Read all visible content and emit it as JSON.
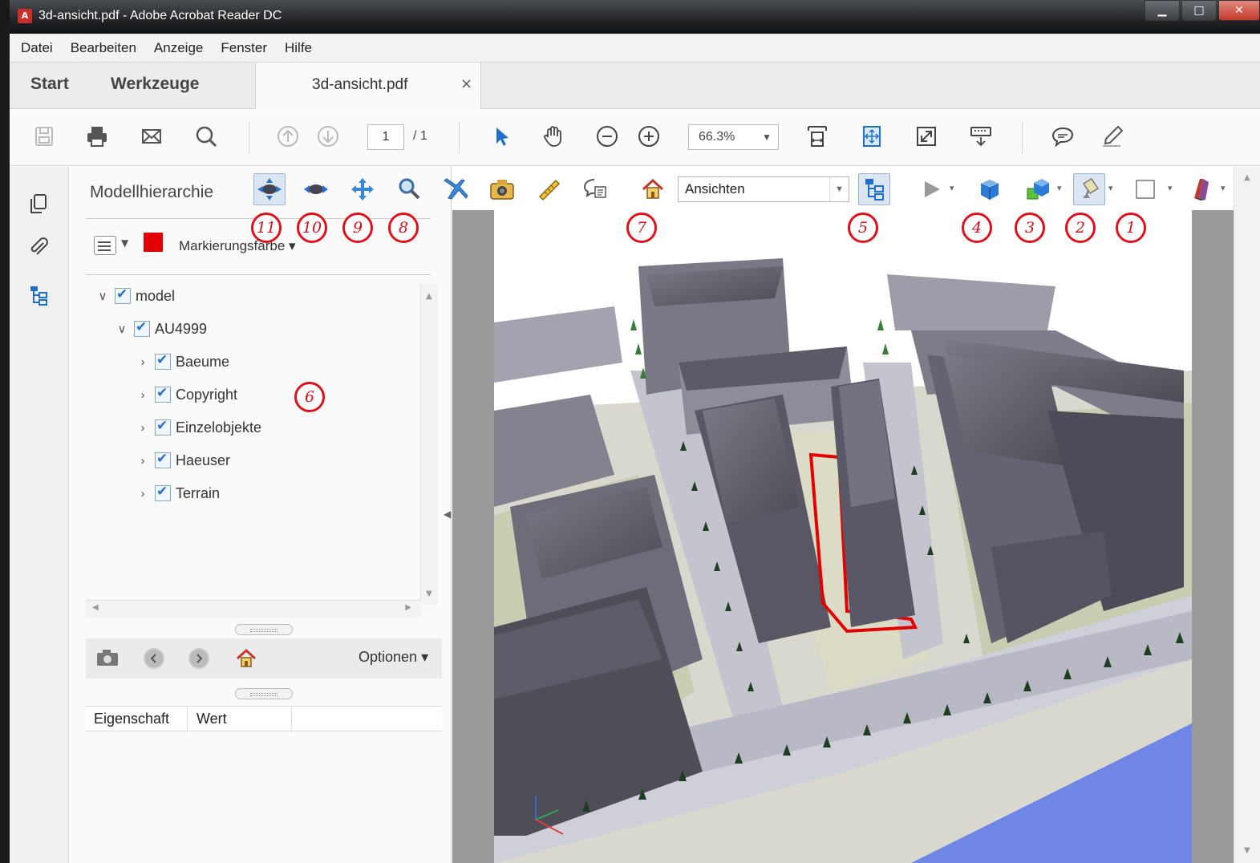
{
  "window": {
    "title": "3d-ansicht.pdf - Adobe Acrobat Reader DC"
  },
  "menu": [
    "Datei",
    "Bearbeiten",
    "Anzeige",
    "Fenster",
    "Hilfe"
  ],
  "tabs": {
    "start": "Start",
    "tools": "Werkzeuge",
    "document": "3d-ansicht.pdf",
    "close": "×"
  },
  "toolbar": {
    "page_current": "1",
    "page_total": "/ 1",
    "zoom": "66.3%"
  },
  "panel": {
    "title": "Modellhierarchie",
    "marker_label": "Markierungsfarbe",
    "marker_color": "#e30000",
    "tree": [
      {
        "label": "model",
        "level": 0,
        "expanded": true
      },
      {
        "label": "AU4999",
        "level": 1,
        "expanded": true
      },
      {
        "label": "Baeume",
        "level": 2,
        "expanded": false
      },
      {
        "label": "Copyright",
        "level": 2,
        "expanded": false
      },
      {
        "label": "Einzelobjekte",
        "level": 2,
        "expanded": false
      },
      {
        "label": "Haeuser",
        "level": 2,
        "expanded": false
      },
      {
        "label": "Terrain",
        "level": 2,
        "expanded": false
      }
    ],
    "options_label": "Optionen",
    "props_columns": [
      "Eigenschaft",
      "Wert"
    ]
  },
  "toolbar3d": {
    "views_label": "Ansichten"
  },
  "callouts": [
    "1",
    "2",
    "3",
    "4",
    "5",
    "6",
    "7",
    "8",
    "9",
    "10",
    "11"
  ],
  "colors": {
    "callout": "#e0101a",
    "selection_outline": "#e30000",
    "water": "#6f86e6"
  }
}
